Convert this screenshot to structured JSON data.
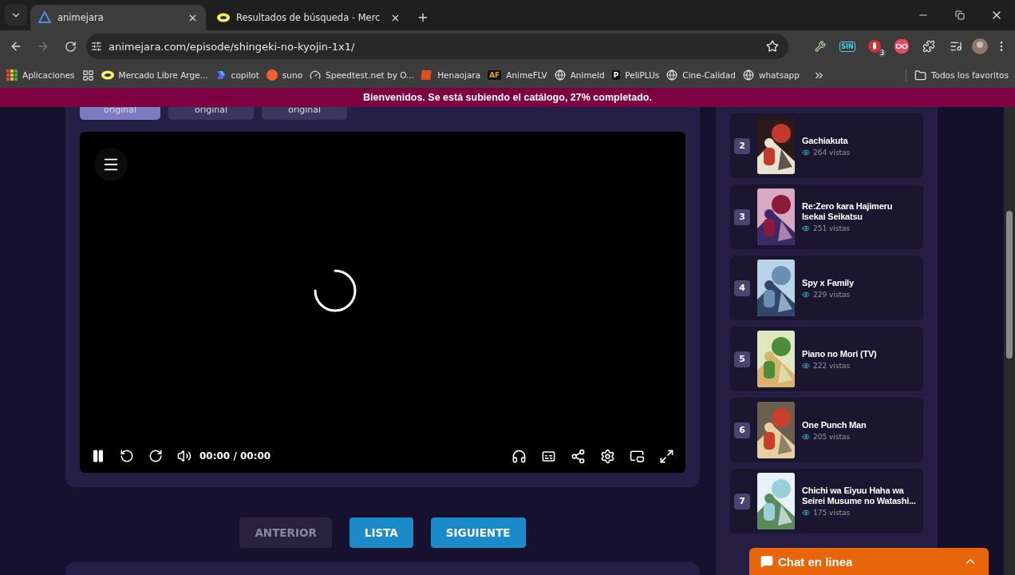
{
  "browser": {
    "tabs": [
      {
        "title": "animejara",
        "selected": true
      },
      {
        "title": "Resultados de búsqueda - Merc",
        "selected": false
      }
    ],
    "address": "animejara.com/episode/shingeki-no-kyojin-1x1/",
    "extensions": [
      {
        "kind": "wrench"
      },
      {
        "kind": "text",
        "label": "SIN"
      },
      {
        "kind": "badge",
        "label": "3"
      },
      {
        "kind": "infinity"
      },
      {
        "kind": "puzzle"
      }
    ],
    "bookmarks": [
      {
        "kind": "apps",
        "title": "Aplicaciones"
      },
      {
        "kind": "mercado",
        "title": "Mercado Libre Arge..."
      },
      {
        "kind": "copilot",
        "title": "copilot"
      },
      {
        "kind": "suno",
        "title": "suno"
      },
      {
        "kind": "speed",
        "title": "Speedtest.net by O..."
      },
      {
        "kind": "henao",
        "title": "Henaojara"
      },
      {
        "kind": "letter",
        "letter": "AF",
        "title": "AnimeFLV"
      },
      {
        "kind": "globe",
        "title": "Animeld"
      },
      {
        "kind": "letter",
        "letter": "P",
        "title": "PeliPLUs"
      },
      {
        "kind": "globe",
        "title": "Cine-Calidad"
      },
      {
        "kind": "globe",
        "title": "whatsapp"
      }
    ],
    "all_bookmarks": "Todos los favoritos"
  },
  "banner": "Bienvenidos. Se está subiendo el catálogo, 27% completado.",
  "servers": [
    {
      "label": "original",
      "selected": true
    },
    {
      "label": "original",
      "selected": false
    },
    {
      "label": "original",
      "selected": false
    }
  ],
  "player": {
    "time": "00:00",
    "separator": "/",
    "duration": "00:00"
  },
  "nav": [
    {
      "label": "ANTERIOR",
      "disabled": true
    },
    {
      "label": "LISTA",
      "disabled": false
    },
    {
      "label": "SIGUIENTE",
      "disabled": false
    }
  ],
  "ranking": [
    {
      "rank": "2",
      "title": "Gachiakuta",
      "views": "264 vistas"
    },
    {
      "rank": "3",
      "title": "Re:Zero kara Hajimeru Isekai Seikatsu",
      "views": "251 vistas"
    },
    {
      "rank": "4",
      "title": "Spy x Family",
      "views": "229 vistas"
    },
    {
      "rank": "5",
      "title": "Piano no Mori (TV)",
      "views": "222 vistas"
    },
    {
      "rank": "6",
      "title": "One Punch Man",
      "views": "205 vistas"
    },
    {
      "rank": "7",
      "title": "Chichi wa Eiyuu Haha wa Seirei Musume no Watashi...",
      "views": "175 vistas"
    }
  ],
  "chat": {
    "label": "Chat en linea"
  }
}
